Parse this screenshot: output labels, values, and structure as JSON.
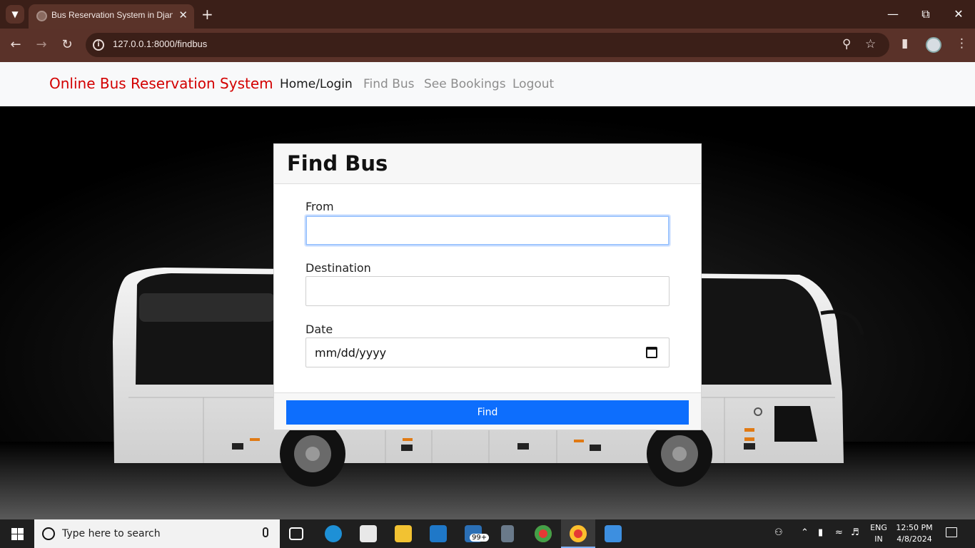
{
  "browser": {
    "tab_title": "Bus Reservation System in Djan",
    "url": "127.0.0.1:8000/findbus"
  },
  "site": {
    "brand": "Online Bus Reservation System",
    "nav": [
      {
        "label": "Home/Login",
        "active": true
      },
      {
        "label": "Find Bus",
        "active": false
      },
      {
        "label": "See Bookings",
        "active": false
      },
      {
        "label": "Logout",
        "active": false
      }
    ]
  },
  "form": {
    "title": "Find Bus",
    "from_label": "From",
    "from_value": "",
    "destination_label": "Destination",
    "destination_value": "",
    "date_label": "Date",
    "date_placeholder": "mm/dd/yyyy",
    "submit_label": "Find"
  },
  "taskbar": {
    "search_placeholder": "Type here to search",
    "mail_badge": "99+",
    "lang_line1": "ENG",
    "lang_line2": "IN",
    "time": "12:50 PM",
    "date": "4/8/2024"
  },
  "colors": {
    "brand": "#d30000",
    "primary_button": "#0d6efd",
    "chrome_dark": "#3b1f18",
    "chrome_mid": "#5a3229"
  }
}
